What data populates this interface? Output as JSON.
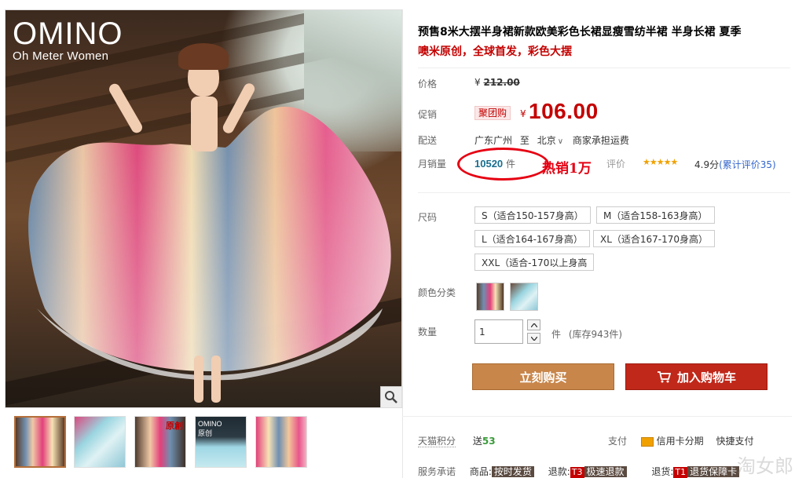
{
  "brand": {
    "name": "OMINO",
    "tagline": "Oh Meter Women"
  },
  "thumbnails": [
    {
      "name": "photo-1",
      "text": "",
      "active": true
    },
    {
      "name": "photo-2",
      "text": "",
      "active": false
    },
    {
      "name": "photo-3",
      "text": "原創",
      "active": false
    },
    {
      "name": "photo-4",
      "text": "OMINO 原创",
      "active": false
    },
    {
      "name": "photo-5",
      "text": "",
      "active": false
    }
  ],
  "product": {
    "title": "预售8米大摆半身裙新款欧美彩色长裙显瘦雪纺半裙 半身长裙 夏季",
    "subtitle": "噢米原创，全球首发，彩色大摆"
  },
  "price": {
    "label": "价格",
    "currency": "¥",
    "original": "212.00"
  },
  "promo": {
    "label": "促销",
    "tag": "聚团购",
    "currency": "¥",
    "price": "106.00"
  },
  "shipping": {
    "label": "配送",
    "from": "广东广州",
    "to_word": "至",
    "to": "北京",
    "fee": "商家承担运费"
  },
  "sales": {
    "label": "月销量",
    "count": "10520",
    "unit": "件",
    "annotation": "热销1万"
  },
  "reviews": {
    "label": "评价",
    "stars": "★★★★★",
    "score": "4.9分",
    "count_text": "(累计评价35)"
  },
  "sizes": {
    "label": "尺码",
    "options": [
      "S（适合150-157身高）",
      "M（适合158-163身高）",
      "L（适合164-167身高）",
      "XL（适合167-170身高）",
      "XXL（适合-170以上身高"
    ]
  },
  "colors": {
    "label": "颜色分类"
  },
  "quantity": {
    "label": "数量",
    "value": "1",
    "unit": "件",
    "stock": "(库存943件)"
  },
  "actions": {
    "buy_now": "立刻购买",
    "add_cart": "加入购物车"
  },
  "points": {
    "label": "天猫积分",
    "prefix": "送",
    "value": "53",
    "pay_label": "支付",
    "pay_method": "信用卡分期",
    "quick": "快捷支付"
  },
  "service": {
    "label": "服务承诺",
    "goods_label": "商品:",
    "goods_badge": "按时发货",
    "refund_label": "退款:",
    "refund_badge_code": "T3",
    "refund_badge": "极速退款",
    "return_label": "退货:",
    "return_badge_code": "T1",
    "return_badge": "退货保障卡"
  },
  "watermark": "淘女郎"
}
